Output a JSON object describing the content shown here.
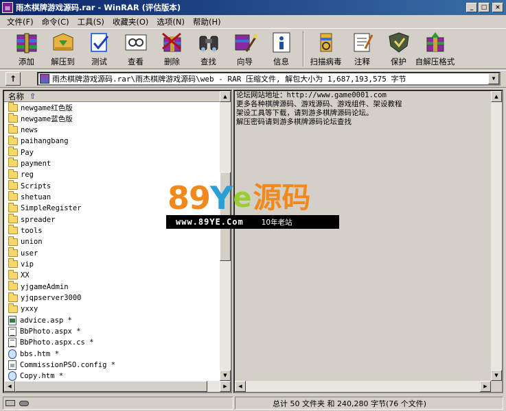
{
  "window": {
    "title": "雨杰棋牌游戏源码.rar - WinRAR (评估版本)",
    "buttons": [
      "_",
      "□",
      "×"
    ]
  },
  "menu": [
    "文件(F)",
    "命令(C)",
    "工具(S)",
    "收藏夹(O)",
    "选项(N)",
    "帮助(H)"
  ],
  "toolbar": [
    {
      "label": "添加",
      "icon": "add-archive-icon"
    },
    {
      "label": "解压到",
      "icon": "extract-to-icon"
    },
    {
      "label": "测试",
      "icon": "test-icon"
    },
    {
      "label": "查看",
      "icon": "view-icon"
    },
    {
      "label": "删除",
      "icon": "delete-icon"
    },
    {
      "label": "查找",
      "icon": "find-icon"
    },
    {
      "label": "向导",
      "icon": "wizard-icon"
    },
    {
      "label": "信息",
      "icon": "info-icon"
    },
    {
      "label": "扫描病毒",
      "icon": "virus-scan-icon"
    },
    {
      "label": "注释",
      "icon": "comment-icon"
    },
    {
      "label": "保护",
      "icon": "protect-icon"
    },
    {
      "label": "自解压格式",
      "icon": "sfx-icon"
    }
  ],
  "address": {
    "up_label": "↑",
    "path": "雨杰棋牌游戏源码.rar\\雨杰棋牌游戏源码\\web - RAR 压缩文件, 解包大小为 1,687,193,575 字节"
  },
  "file_list": {
    "column_name": "名称",
    "sort_glyph": "⇧",
    "items": [
      {
        "name": "newgame红色版",
        "type": "folder"
      },
      {
        "name": "newgame蓝色版",
        "type": "folder"
      },
      {
        "name": "news",
        "type": "folder"
      },
      {
        "name": "paihangbang",
        "type": "folder"
      },
      {
        "name": "Pay",
        "type": "folder"
      },
      {
        "name": "payment",
        "type": "folder"
      },
      {
        "name": "reg",
        "type": "folder"
      },
      {
        "name": "Scripts",
        "type": "folder"
      },
      {
        "name": "shetuan",
        "type": "folder"
      },
      {
        "name": "SimpleRegister",
        "type": "folder"
      },
      {
        "name": "spreader",
        "type": "folder"
      },
      {
        "name": "tools",
        "type": "folder"
      },
      {
        "name": "union",
        "type": "folder"
      },
      {
        "name": "user",
        "type": "folder"
      },
      {
        "name": "vip",
        "type": "folder"
      },
      {
        "name": "XX",
        "type": "folder"
      },
      {
        "name": "yjgameAdmin",
        "type": "folder"
      },
      {
        "name": "yjqpserver3000",
        "type": "folder"
      },
      {
        "name": "yxxy",
        "type": "folder"
      },
      {
        "name": "advice.asp *",
        "type": "asp"
      },
      {
        "name": "BbPhoto.aspx *",
        "type": "aspx"
      },
      {
        "name": "BbPhoto.aspx.cs *",
        "type": "aspx"
      },
      {
        "name": "bbs.htm *",
        "type": "htm"
      },
      {
        "name": "CommissionPSO.config *",
        "type": "cfg"
      },
      {
        "name": "Copy.htm *",
        "type": "htm"
      }
    ]
  },
  "comment": {
    "lines": [
      "论坛网站地址：http://www.game0001.com",
      "",
      "更多各种棋牌源码、游戏源码、游戏组件、架设教程",
      "架设工具等下载，请到游多棋牌源码论坛。",
      "",
      "解压密码请到游多棋牌源码论坛查找"
    ]
  },
  "watermark": {
    "big_89": "89",
    "big_y": "Y",
    "big_e": "e",
    "big_cn": "源码",
    "url": "www.89YE.Com",
    "tag": "10年老站"
  },
  "status": {
    "summary": "总计 50 文件夹 和 240,280 字节(76 个文件)"
  },
  "colors": {
    "title_start": "#0a246a",
    "title_end": "#3a6ea5",
    "watermark_orange": "#f08a1c",
    "watermark_blue": "#2a9fd6"
  }
}
